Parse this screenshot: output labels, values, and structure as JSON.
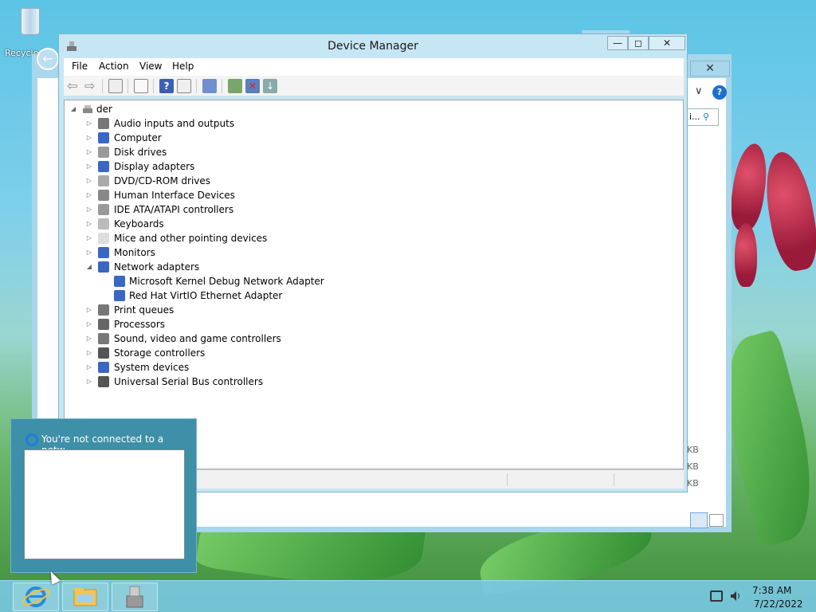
{
  "desktop": {
    "recycle_bin_label": "Recycle Bin"
  },
  "background_window": {
    "search_partial": "i...",
    "kb_labels": [
      "KB",
      "KB",
      "KB"
    ]
  },
  "device_manager": {
    "title": "Device Manager",
    "window_buttons": {
      "minimize": "—",
      "maximize": "◻",
      "close": "✕"
    },
    "menu": [
      "File",
      "Action",
      "View",
      "Help"
    ],
    "toolbar_icons": [
      "back-icon",
      "forward-icon",
      "properties-pane-icon",
      "list-icon",
      "help-icon",
      "view-icon",
      "scan-hardware-icon",
      "update-driver-icon",
      "uninstall-icon",
      "disable-icon"
    ],
    "tree": {
      "root": "der",
      "categories": [
        {
          "label": "Audio inputs and outputs",
          "expanded": false,
          "icon": "speaker-icon"
        },
        {
          "label": "Computer",
          "expanded": false,
          "icon": "computer-icon"
        },
        {
          "label": "Disk drives",
          "expanded": false,
          "icon": "disk-icon"
        },
        {
          "label": "Display adapters",
          "expanded": false,
          "icon": "display-icon"
        },
        {
          "label": "DVD/CD-ROM drives",
          "expanded": false,
          "icon": "dvd-icon"
        },
        {
          "label": "Human Interface Devices",
          "expanded": false,
          "icon": "hid-icon"
        },
        {
          "label": "IDE ATA/ATAPI controllers",
          "expanded": false,
          "icon": "ide-icon"
        },
        {
          "label": "Keyboards",
          "expanded": false,
          "icon": "keyboard-icon"
        },
        {
          "label": "Mice and other pointing devices",
          "expanded": false,
          "icon": "mouse-icon"
        },
        {
          "label": "Monitors",
          "expanded": false,
          "icon": "monitor-icon"
        },
        {
          "label": "Network adapters",
          "expanded": true,
          "icon": "network-icon",
          "children": [
            "Microsoft Kernel Debug Network Adapter",
            "Red Hat VirtIO Ethernet Adapter"
          ]
        },
        {
          "label": "Print queues",
          "expanded": false,
          "icon": "printer-icon"
        },
        {
          "label": "Processors",
          "expanded": false,
          "icon": "processor-icon"
        },
        {
          "label": "Sound, video and game controllers",
          "expanded": false,
          "icon": "sound-icon"
        },
        {
          "label": "Storage controllers",
          "expanded": false,
          "icon": "storage-icon"
        },
        {
          "label": "System devices",
          "expanded": false,
          "icon": "system-icon"
        },
        {
          "label": "Universal Serial Bus controllers",
          "expanded": false,
          "icon": "usb-icon"
        }
      ]
    }
  },
  "notification": {
    "title": "You're not connected to a netw..."
  },
  "taskbar": {
    "apps": [
      "internet-explorer-icon",
      "file-explorer-icon",
      "device-manager-icon"
    ],
    "time": "7:38 AM",
    "date": "7/22/2022"
  },
  "colors": {
    "taskbar": "#78c8e1",
    "window_frame": "#c6e6f3",
    "accent": "#1e7dd6"
  }
}
